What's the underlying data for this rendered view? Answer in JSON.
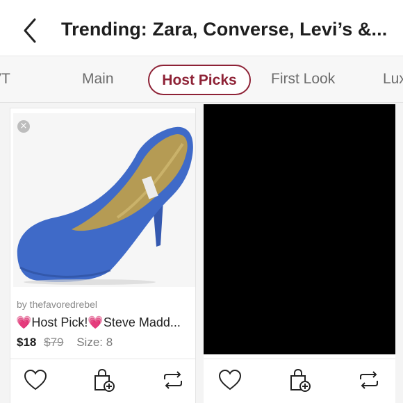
{
  "header": {
    "title": "Trending: Zara, Converse, Levi’s &..."
  },
  "tabs": [
    {
      "label": "VT"
    },
    {
      "label": "Main"
    },
    {
      "label": "Host Picks",
      "active": true
    },
    {
      "label": "First Look"
    },
    {
      "label": "Lux"
    }
  ],
  "listings": [
    {
      "seller": "by thefavoredrebel",
      "title": "💗Host Pick!💗Steve Madd...",
      "price": "$18",
      "original_price": "$79",
      "size": "Size: 8",
      "image": "blue-suede-pump"
    },
    {
      "image": "black-placeholder"
    }
  ],
  "icons": {
    "back": "chevron-left-icon",
    "close": "close-icon",
    "like": "heart-icon",
    "bundle": "shopping-bag-plus-icon",
    "share": "share-repeat-icon"
  },
  "colors": {
    "accent": "#8e2236",
    "shoe": "#3f6ac8",
    "muted_text": "#8a8a8a"
  }
}
